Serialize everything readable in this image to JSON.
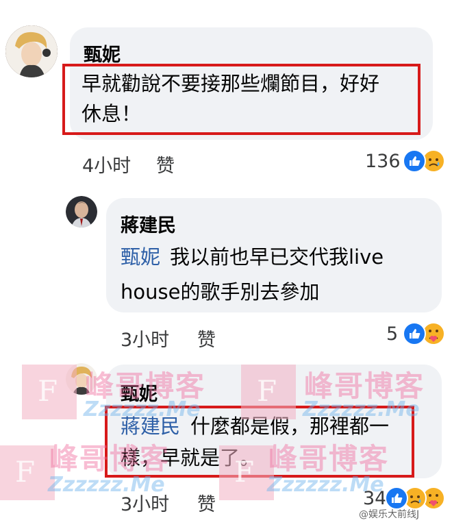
{
  "comments": [
    {
      "author": "甄妮",
      "mention": "",
      "line1": "早就勸說不要接那些爛節目，好好",
      "line2": "休息！",
      "time": "4小时",
      "like_label": "赞",
      "count": "136",
      "reactions": [
        "like-icon",
        "sad-icon"
      ]
    },
    {
      "author": "蔣建民",
      "mention": "甄妮",
      "line1": "我以前也早已交代我live",
      "line2": "house的歌手別去參加",
      "time": "3小时",
      "like_label": "赞",
      "count": "5",
      "reactions": [
        "like-icon",
        "care-icon"
      ]
    },
    {
      "author": "甄妮",
      "mention": "蔣建民",
      "line1": "什麼都是假，那裡都一",
      "line2": "樣，早就是了。",
      "time": "3小时",
      "like_label": "赞",
      "count": "34",
      "reactions": [
        "like-icon",
        "sad-icon",
        "care-icon"
      ]
    }
  ],
  "watermark": {
    "big_text": "峰哥博客",
    "small_text": "Zzzzzz.Me",
    "square_letter": "F",
    "corner_credit": "@娱乐大前线J"
  },
  "colors": {
    "bubble": "#f0f2f5",
    "highlight_box": "#d71a1a",
    "mention": "#2d5fa7",
    "like_blue": "#1877f2"
  }
}
